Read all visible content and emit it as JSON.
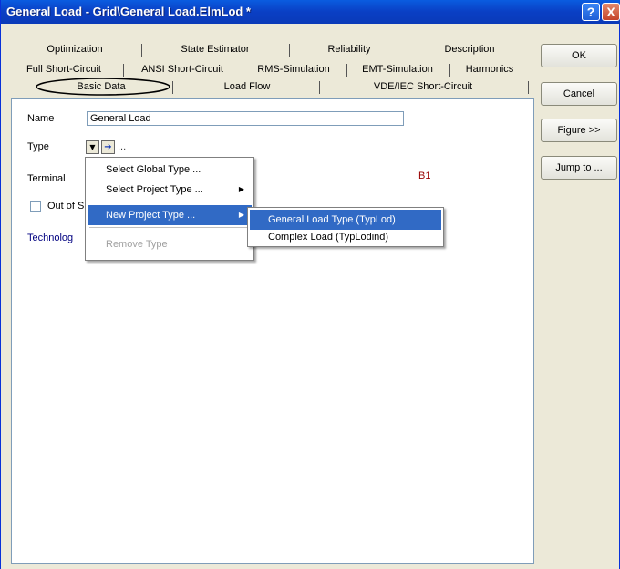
{
  "window": {
    "title": "General Load - Grid\\General Load.ElmLod *",
    "help_glyph": "?",
    "close_glyph": "X"
  },
  "tabs": {
    "row1": [
      "Optimization",
      "State Estimator",
      "Reliability",
      "Description"
    ],
    "row2": [
      "Full Short-Circuit",
      "ANSI Short-Circuit",
      "RMS-Simulation",
      "EMT-Simulation",
      "Harmonics"
    ],
    "row3": [
      "Basic Data",
      "Load Flow",
      "VDE/IEC Short-Circuit"
    ]
  },
  "buttons": {
    "ok": "OK",
    "cancel": "Cancel",
    "figure": "Figure >>",
    "jump": "Jump to ..."
  },
  "form": {
    "name_label": "Name",
    "name_value": "General Load",
    "type_label": "Type",
    "type_ellipsis": "...",
    "terminal_label": "Terminal",
    "terminal_value": "B1",
    "out_of_service_label": "Out of S",
    "technology_label": "Technolog"
  },
  "context_menu": {
    "items": [
      "Select Global Type ...",
      "Select Project Type ...",
      "New Project Type ...",
      "Remove Type"
    ]
  },
  "submenu": {
    "items": [
      "General Load Type (TypLod)",
      "Complex Load (TypLodind)"
    ]
  },
  "colors": {
    "titlebar": "#0a3fc4",
    "highlight": "#316ac5",
    "terminal_value": "#990000",
    "technology_link": "#000080"
  }
}
